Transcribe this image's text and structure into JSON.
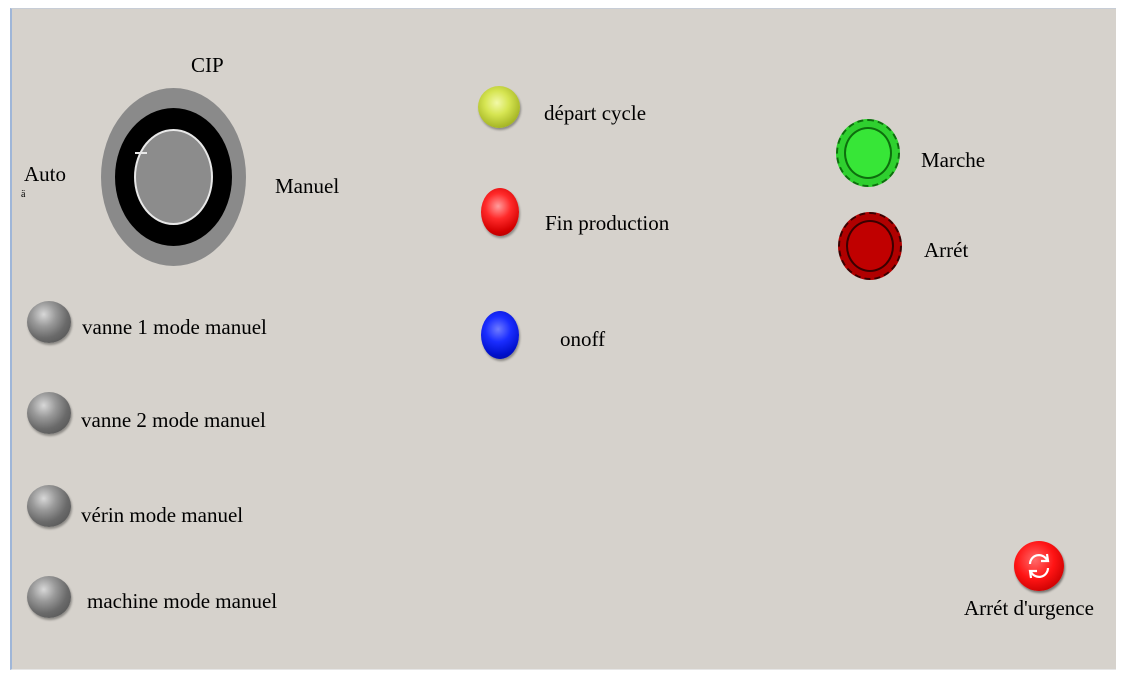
{
  "selector": {
    "title": "CIP",
    "left_label": "Auto",
    "right_label": "Manuel"
  },
  "manual_lamps": [
    {
      "label": "vanne 1 mode manuel",
      "color": "#6a6a6a"
    },
    {
      "label": "vanne 2 mode manuel",
      "color": "#6a6a6a"
    },
    {
      "label": "vérin mode manuel",
      "color": "#6a6a6a"
    },
    {
      "label": "machine mode manuel",
      "color": "#6a6a6a"
    }
  ],
  "status_lamps": [
    {
      "label": "départ cycle",
      "color": "#d6e552"
    },
    {
      "label": "Fin production",
      "color": "#ff2a2a"
    },
    {
      "label": "onoff",
      "color": "#1a2dff"
    }
  ],
  "buttons": {
    "marche": {
      "label": "Marche",
      "color": "#2fd02f"
    },
    "arret": {
      "label": "Arrét",
      "color": "#b00000"
    },
    "emergency": {
      "label": "Arrét d'urgence",
      "color": "#ff1414"
    }
  }
}
